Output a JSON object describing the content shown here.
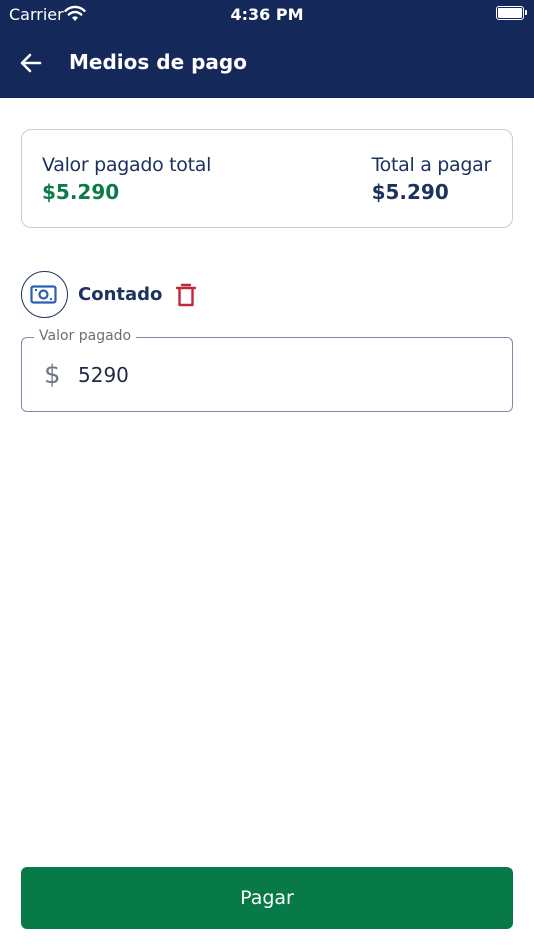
{
  "status_bar": {
    "carrier": "Carrier",
    "time": "4:36 PM"
  },
  "header": {
    "title": "Medios de pago",
    "back_icon": "arrow-left-icon"
  },
  "summary": {
    "paid_label": "Valor pagado total",
    "paid_value": "$5.290",
    "total_label": "Total a pagar",
    "total_value": "$5.290"
  },
  "payment_method": {
    "label": "Contado",
    "icon": "cash-icon",
    "delete_icon": "trash-icon"
  },
  "amount_field": {
    "label": "Valor pagado",
    "currency_symbol": "$",
    "value": "5290"
  },
  "actions": {
    "pay_label": "Pagar"
  },
  "colors": {
    "header_bg": "#14295a",
    "accent_green": "#077a48",
    "paid_green": "#0d7a4a",
    "navy_text": "#1e3260",
    "delete_red": "#c0283a"
  }
}
